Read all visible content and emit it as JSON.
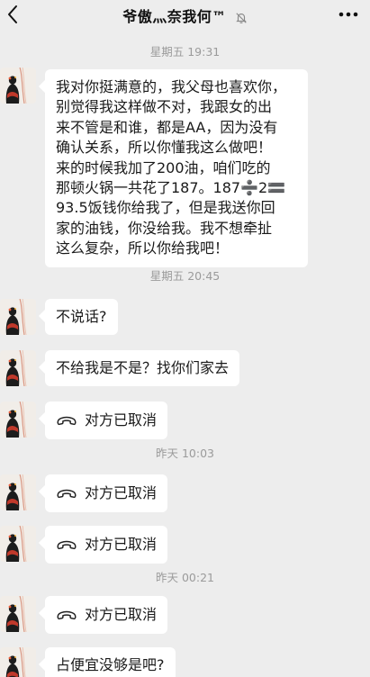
{
  "header": {
    "title": "爷傲灬奈我何™",
    "back_icon": "chevron-left-icon",
    "mute_icon": "bell-off-icon",
    "more_icon": "more-dots-icon"
  },
  "timestamps": [
    "星期五 19:31",
    "星期五 20:45",
    "昨天 10:03",
    "昨天 00:21"
  ],
  "messages": {
    "m1": {
      "lines": [
        "我对你挺满意的，我父母也喜欢你，",
        "别觉得我这样做不对，我跟女的出",
        "来不管是和谁，都是AA，因为没有",
        "确认关系，所以你懂我这么做吧！",
        "来的时候我加了200油，咱们吃的",
        "那顿火锅一共花了187。187➗2🟰",
        "93.5饭钱你给我了，但是我送你回",
        "家的油钱，你没给我。我不想牵扯",
        "这么复杂，所以你给我吧！"
      ]
    },
    "m2": {
      "text": "不说话?"
    },
    "m3": {
      "text": "不给我是不是？找你们家去"
    },
    "call1": {
      "text": "对方已取消",
      "icon": "phone-hangup-icon"
    },
    "call2": {
      "text": "对方已取消",
      "icon": "phone-hangup-icon"
    },
    "call3": {
      "text": "对方已取消",
      "icon": "phone-hangup-icon"
    },
    "call4": {
      "text": "对方已取消",
      "icon": "phone-hangup-icon"
    },
    "m4": {
      "text": "占便宜没够是吧?"
    }
  },
  "colors": {
    "background": "#ededed",
    "bubble": "#ffffff",
    "timestamp": "#9b9b9b"
  }
}
